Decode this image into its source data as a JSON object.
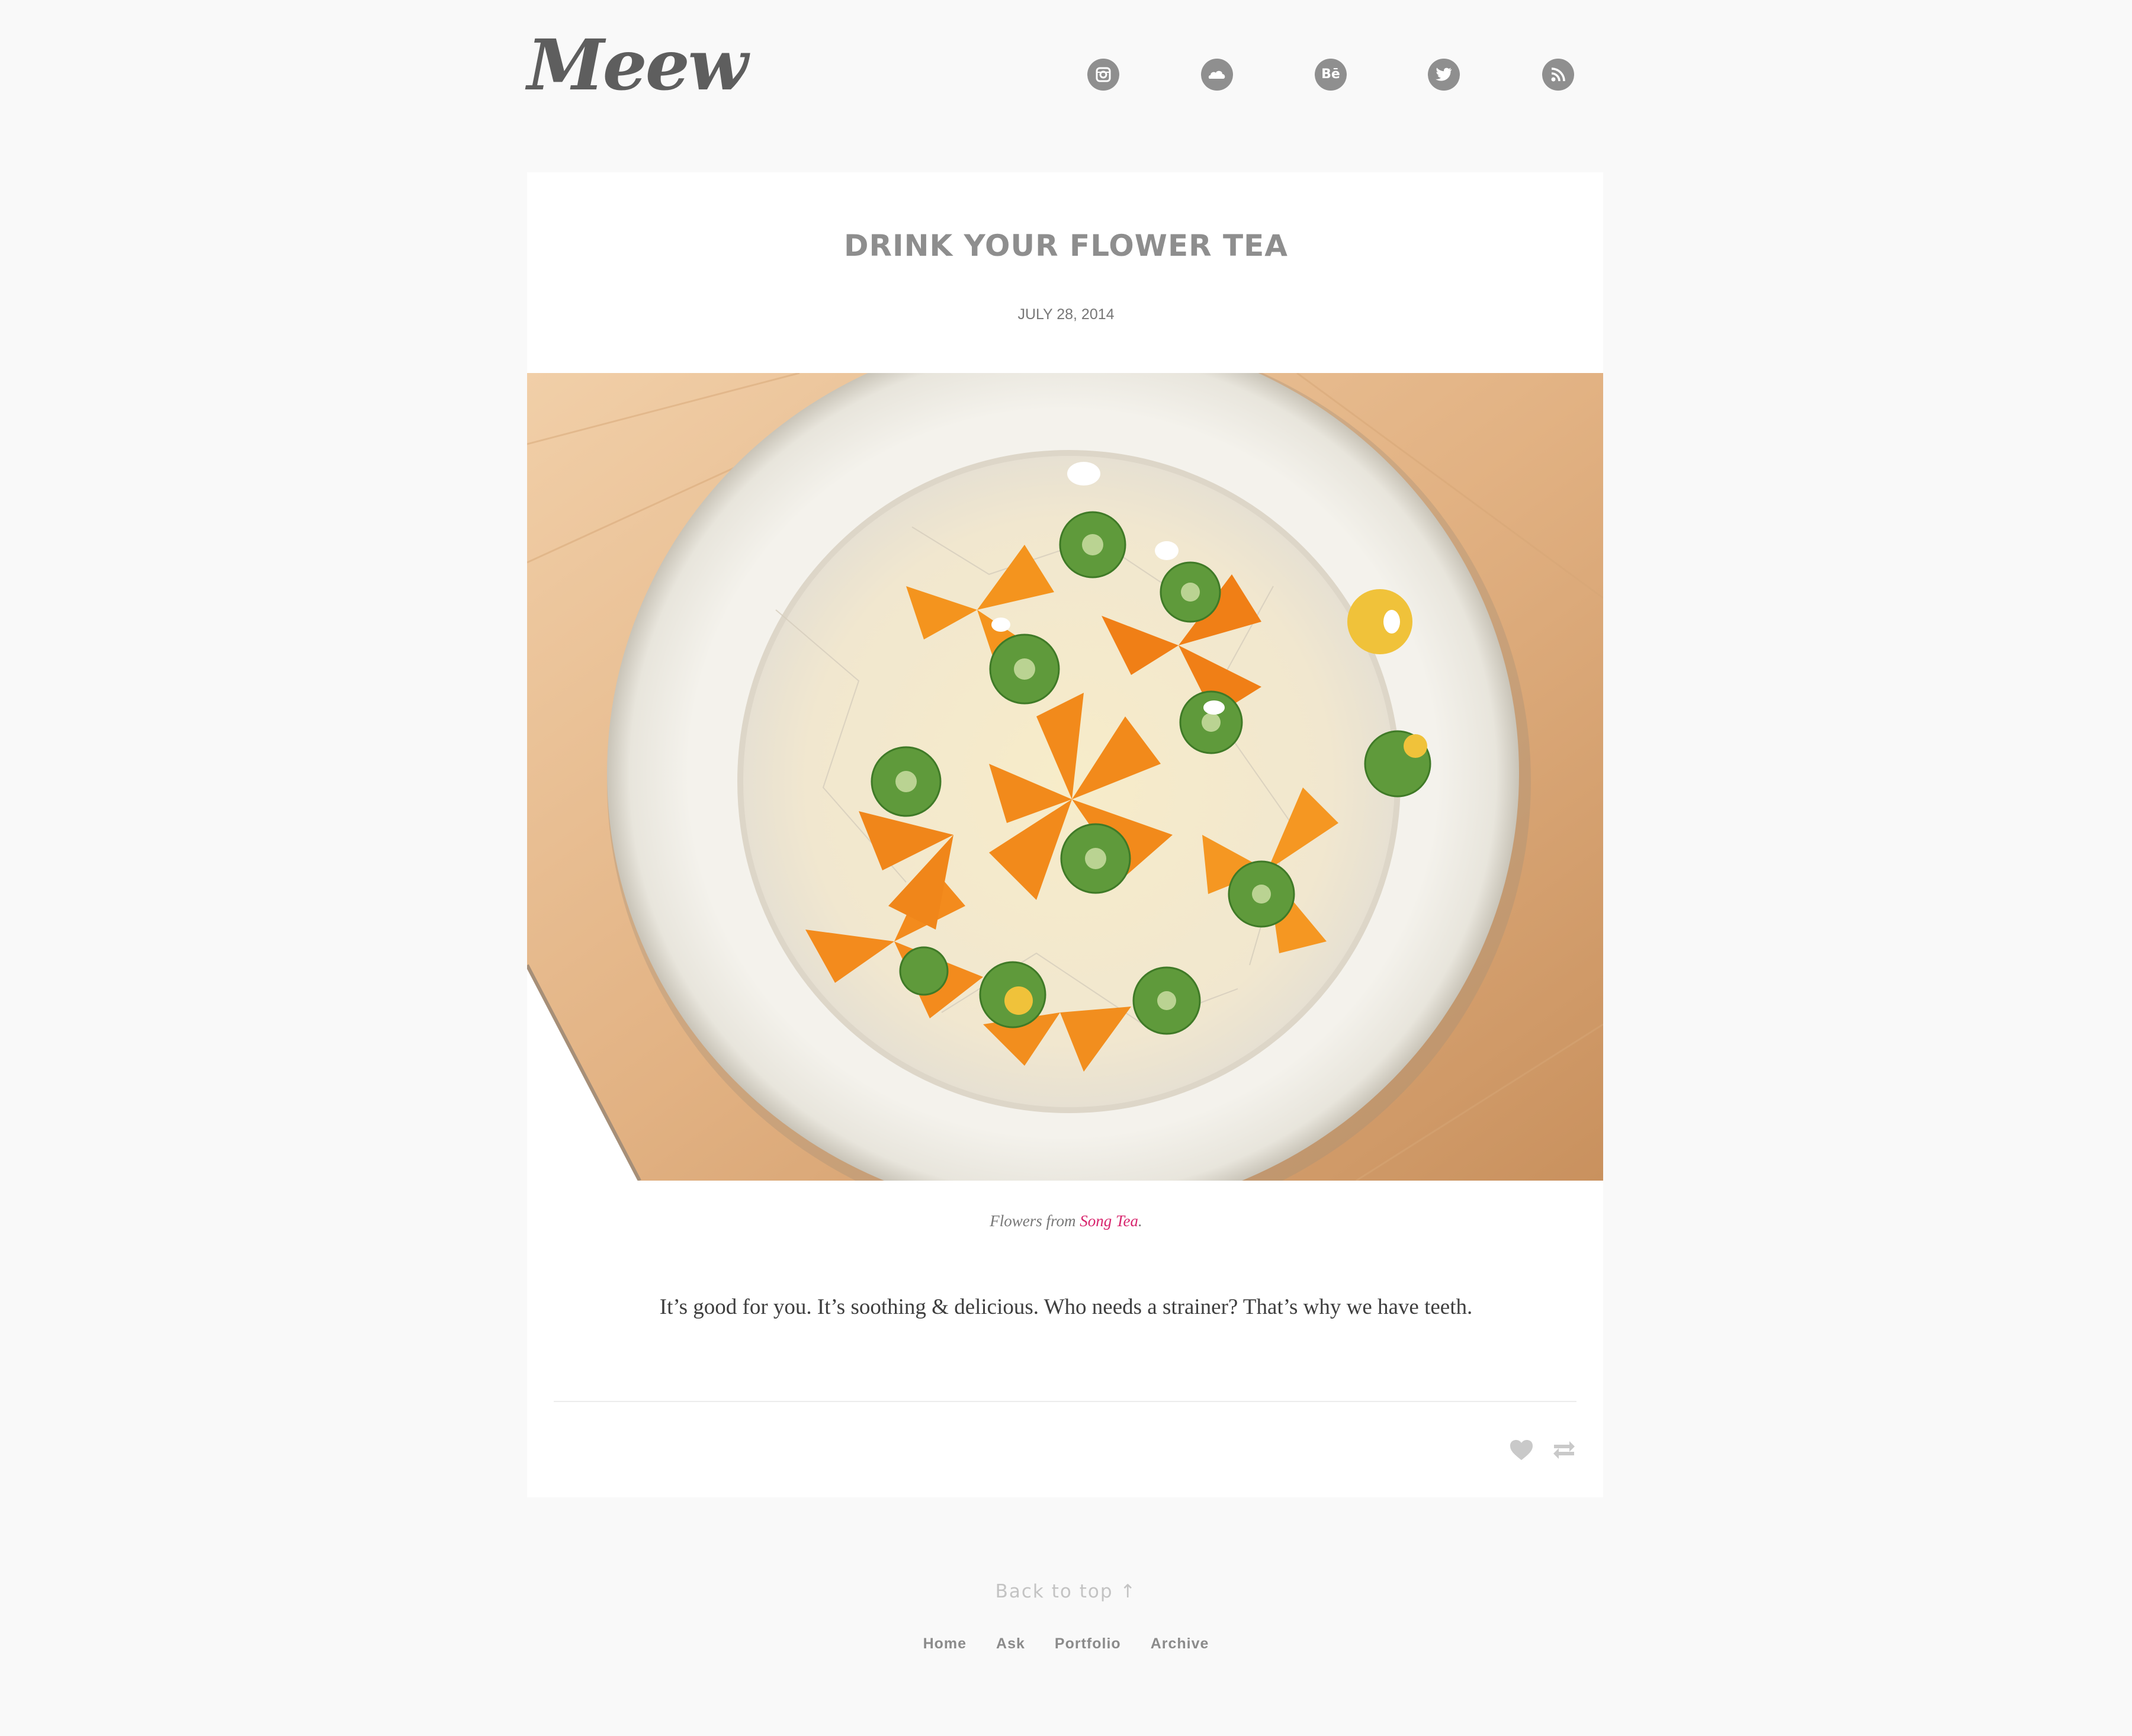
{
  "header": {
    "logo_text": "Meew",
    "social_links": [
      {
        "icon": "instagram-icon"
      },
      {
        "icon": "soundcloud-icon"
      },
      {
        "icon": "behance-icon",
        "glyph": "Bē"
      },
      {
        "icon": "twitter-icon"
      },
      {
        "icon": "rss-icon"
      }
    ]
  },
  "post": {
    "title": "DRINK YOUR FLOWER TEA",
    "date": "JULY 28, 2014",
    "photo_icon": "photo-flower-tea-bowl",
    "caption_prefix": "Flowers from",
    "caption_link": "Song Tea",
    "caption_suffix": ".",
    "body": "It’s good for you. It’s soothing & delicious. Who needs a strainer? That’s why we have teeth.",
    "actions": [
      {
        "icon": "heart-icon"
      },
      {
        "icon": "reblog-icon"
      }
    ]
  },
  "footer": {
    "back_to_top": "Back to top",
    "back_to_top_arrow": "↑",
    "nav": [
      "Home",
      "Ask",
      "Portfolio",
      "Archive"
    ]
  },
  "colors": {
    "background": "#f9f9f9",
    "card": "#ffffff",
    "link_accent": "#d8266e",
    "icon_gray": "#8f8f8f",
    "title_gray": "#8e8e8e"
  }
}
